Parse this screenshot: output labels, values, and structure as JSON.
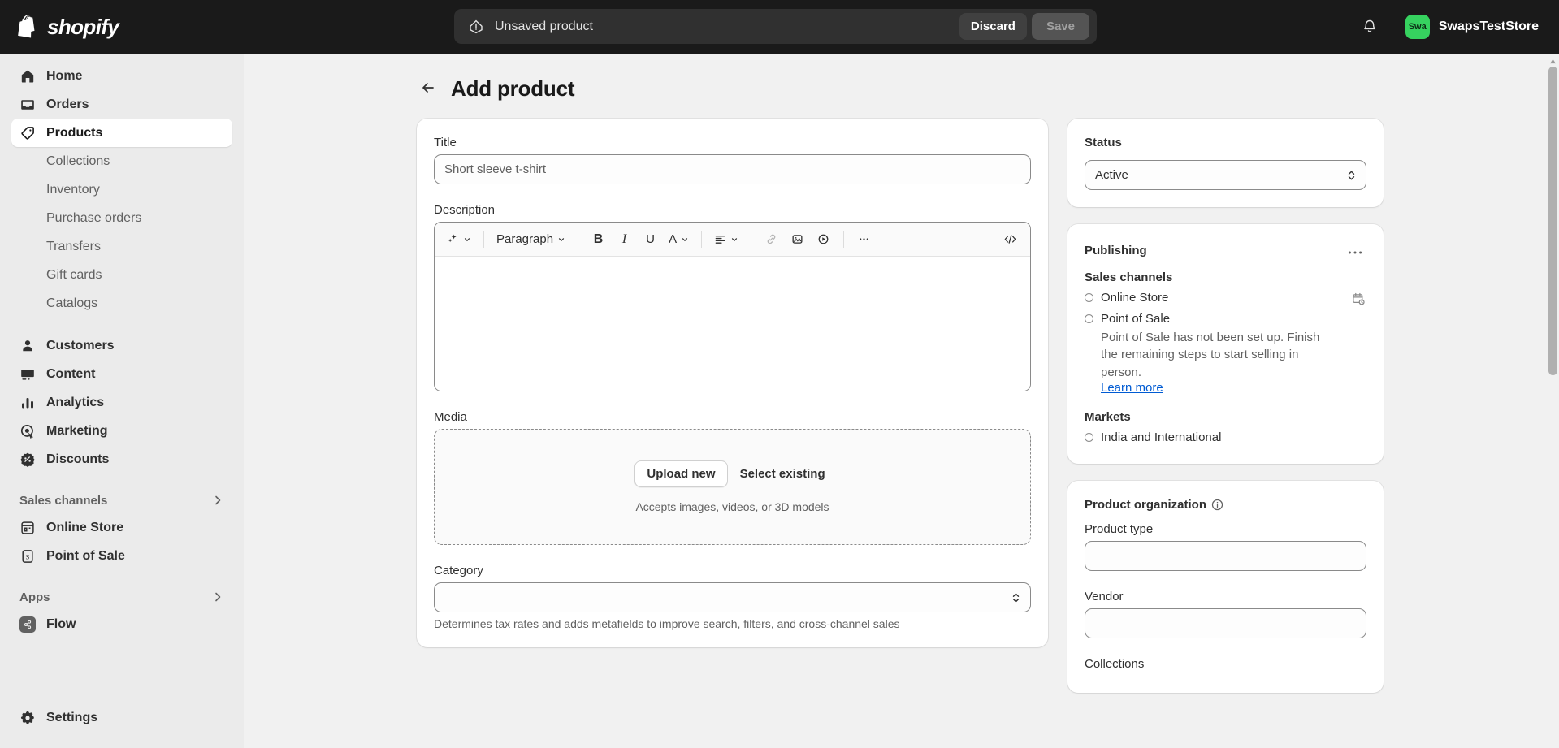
{
  "topbar": {
    "brand_name": "shopify",
    "brand_icon": "shopify-bag-icon",
    "save_banner": {
      "status_icon": "alert-circle-icon",
      "status_text": "Unsaved product",
      "discard_label": "Discard",
      "save_label": "Save"
    },
    "notifications_icon": "bell-icon",
    "store": {
      "avatar_initials": "Swa",
      "avatar_color": "#36d25f",
      "name": "SwapsTestStore"
    }
  },
  "sidebar": {
    "primary": [
      {
        "label": "Home",
        "icon": "home-icon",
        "active": false
      },
      {
        "label": "Orders",
        "icon": "orders-inbox-icon",
        "active": false
      },
      {
        "label": "Products",
        "icon": "tag-icon",
        "active": true
      }
    ],
    "product_subitems": [
      {
        "label": "Collections"
      },
      {
        "label": "Inventory"
      },
      {
        "label": "Purchase orders"
      },
      {
        "label": "Transfers"
      },
      {
        "label": "Gift cards"
      },
      {
        "label": "Catalogs"
      }
    ],
    "secondary": [
      {
        "label": "Customers",
        "icon": "person-icon"
      },
      {
        "label": "Content",
        "icon": "image-icon"
      },
      {
        "label": "Analytics",
        "icon": "bar-chart-icon"
      },
      {
        "label": "Marketing",
        "icon": "target-cursor-icon"
      },
      {
        "label": "Discounts",
        "icon": "discount-badge-icon"
      }
    ],
    "sales_channels_section": {
      "label": "Sales channels",
      "chevron_icon": "chevron-right-icon",
      "items": [
        {
          "label": "Online Store",
          "icon": "storefront-icon"
        },
        {
          "label": "Point of Sale",
          "icon": "pos-register-icon"
        }
      ]
    },
    "apps_section": {
      "label": "Apps",
      "chevron_icon": "chevron-right-icon",
      "items": [
        {
          "label": "Flow",
          "icon": "flow-app-icon"
        }
      ]
    },
    "settings": {
      "label": "Settings",
      "icon": "gear-icon"
    }
  },
  "page": {
    "back_icon": "arrow-left-icon",
    "title": "Add product"
  },
  "main": {
    "title_field": {
      "label": "Title",
      "value": "",
      "placeholder": "Short sleeve t-shirt"
    },
    "description_field": {
      "label": "Description",
      "value": "",
      "toolbar": [
        {
          "name": "magic-ai-icon",
          "glyph": "✦",
          "caret": true,
          "dim": false
        },
        {
          "name": "paragraph-style-select",
          "glyph": "Paragraph",
          "caret": true,
          "dim": false
        },
        {
          "name": "bold-icon",
          "glyph": "B",
          "caret": false,
          "dim": false
        },
        {
          "name": "italic-icon",
          "glyph": "I",
          "caret": false,
          "dim": false
        },
        {
          "name": "underline-icon",
          "glyph": "U",
          "caret": false,
          "dim": false
        },
        {
          "name": "text-color-icon",
          "glyph": "A",
          "caret": true,
          "dim": false
        },
        {
          "name": "align-left-icon",
          "glyph": "≡",
          "caret": true,
          "dim": false
        },
        {
          "name": "link-icon",
          "glyph": "🔗",
          "caret": false,
          "dim": true
        },
        {
          "name": "insert-image-icon",
          "glyph": "▣",
          "caret": false,
          "dim": false
        },
        {
          "name": "insert-video-icon",
          "glyph": "▶",
          "caret": false,
          "dim": false
        },
        {
          "name": "more-options-icon",
          "glyph": "…",
          "caret": false,
          "dim": false
        },
        {
          "name": "html-code-icon",
          "glyph": "</>",
          "caret": false,
          "dim": false
        }
      ]
    },
    "media_field": {
      "label": "Media",
      "upload_label": "Upload new",
      "select_existing_label": "Select existing",
      "hint": "Accepts images, videos, or 3D models"
    },
    "category_field": {
      "label": "Category",
      "value": "",
      "help": "Determines tax rates and adds metafields to improve search, filters, and cross-channel sales",
      "caret_icon": "chevron-updown-icon"
    }
  },
  "side": {
    "status_card": {
      "title": "Status",
      "value": "Active",
      "caret_icon": "chevron-updown-icon"
    },
    "publishing_card": {
      "title": "Publishing",
      "menu_icon": "ellipsis-icon",
      "sales_channels_label": "Sales channels",
      "channels": [
        {
          "label": "Online Store",
          "selected": false,
          "trailing_icon": "calendar-clock-icon",
          "note": "",
          "link": ""
        },
        {
          "label": "Point of Sale",
          "selected": false,
          "trailing_icon": "",
          "note": "Point of Sale has not been set up. Finish the remaining steps to start selling in person.",
          "link": "Learn more"
        }
      ],
      "markets_label": "Markets",
      "markets": [
        {
          "label": "India and International",
          "selected": false
        }
      ]
    },
    "organization_card": {
      "title": "Product organization",
      "info_icon": "info-circle-icon",
      "fields": [
        {
          "label": "Product type",
          "value": ""
        },
        {
          "label": "Vendor",
          "value": ""
        },
        {
          "label": "Collections",
          "value": ""
        }
      ]
    }
  },
  "scrollbar": {
    "up_arrow_icon": "triangle-up-icon",
    "thumb_color": "#b0b0b0"
  }
}
